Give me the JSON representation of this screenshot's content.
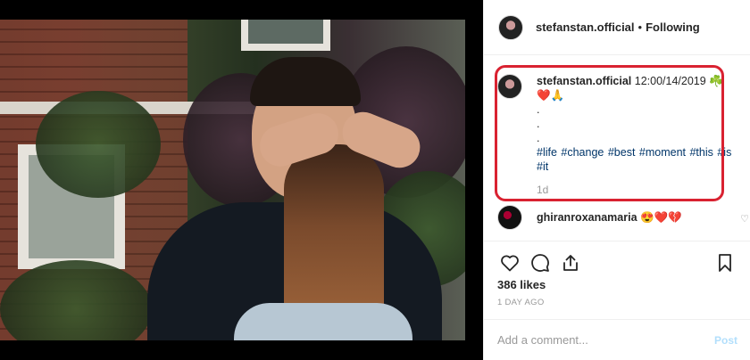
{
  "post": {
    "username": "stefanstan.official",
    "separator": "•",
    "follow_status": "Following"
  },
  "caption": {
    "username": "stefanstan.official",
    "text_line1": "12:00/14/2019 ☘️",
    "emojis": "❤️🙏",
    "dots": [
      ".",
      ".",
      "."
    ],
    "hashtags": "#life #change #best #moment #this #is #it",
    "age": "1d"
  },
  "comment": {
    "username": "ghiranroxanamaria",
    "text": "😍❤️💔"
  },
  "likes": "386 likes",
  "posted_ago": "1 DAY AGO",
  "add_comment": {
    "placeholder": "Add a comment...",
    "post_label": "Post"
  },
  "colors": {
    "highlight_border": "#d92231",
    "hashtag": "#003569",
    "post_button_disabled": "#b2dffc"
  }
}
